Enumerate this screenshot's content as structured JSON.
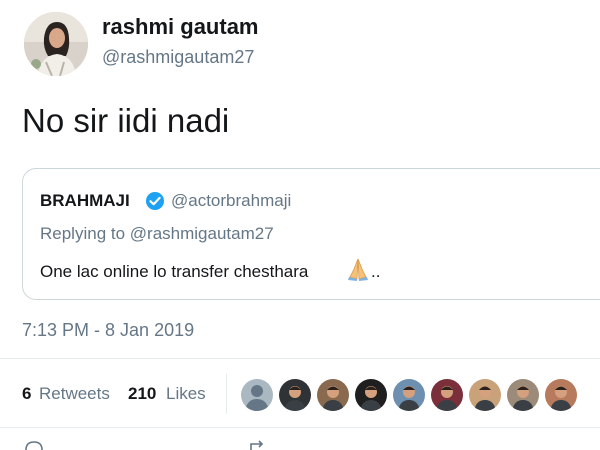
{
  "author": {
    "name": "rashmi gautam",
    "handle": "@rashmigautam27",
    "avatar_icon": "profile-photo-icon"
  },
  "tweet": {
    "text": "No sir iidi nadi"
  },
  "quoted_tweet": {
    "name": "BRAHMAJI",
    "verified": true,
    "verified_icon": "verified-badge-icon",
    "handle": "@actorbrahmaji",
    "replying_to": "Replying to @rashmigautam27",
    "text": "One lac online lo transfer chesthara",
    "emoji_icon": "folded-hands-icon",
    "text_suffix": ".."
  },
  "timestamp": "7:13 PM - 8 Jan 2019",
  "stats": {
    "retweets_count": "6",
    "retweets_label": "Retweets",
    "likes_count": "210",
    "likes_label": "Likes"
  },
  "likers": [
    {
      "name": "liker-1",
      "color": "#aab8c2"
    },
    {
      "name": "liker-2",
      "color": "#2f3336"
    },
    {
      "name": "liker-3",
      "color": "#8a6a4f"
    },
    {
      "name": "liker-4",
      "color": "#1f1f1f"
    },
    {
      "name": "liker-5",
      "color": "#6d8fb0"
    },
    {
      "name": "liker-6",
      "color": "#7a2f3b"
    },
    {
      "name": "liker-7",
      "color": "#c9a27a"
    },
    {
      "name": "liker-8",
      "color": "#9c8b78"
    },
    {
      "name": "liker-9",
      "color": "#b77a5c"
    }
  ],
  "colors": {
    "text_primary": "#14171a",
    "text_secondary": "#657786",
    "border": "#ccd6dd",
    "verified_blue": "#1da1f2"
  }
}
